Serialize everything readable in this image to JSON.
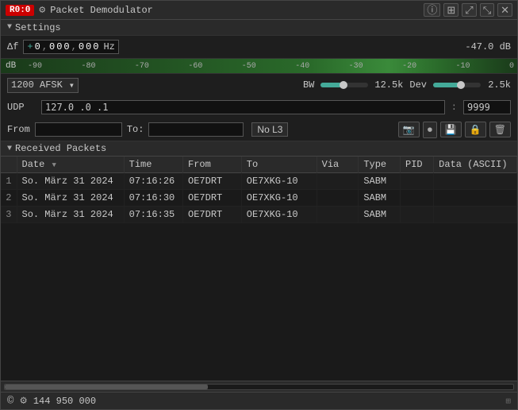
{
  "titlebar": {
    "badge": "R0:0",
    "gear_icon": "⚙",
    "title": "Packet Demodulator",
    "buttons": [
      "⊙",
      "⊞",
      "⤢",
      "⤡",
      "✕"
    ]
  },
  "settings": {
    "header_label": "Settings",
    "df_label": "Δf",
    "df_parts": [
      "+",
      "0",
      ",",
      "0",
      "0",
      "0",
      ",",
      "0",
      "0",
      "0"
    ],
    "df_unit": "Hz",
    "df_value_right": "-47.0",
    "df_db_label": "dB",
    "scale_labels": [
      "-90",
      "-80",
      "-70",
      "-60",
      "-50",
      "-40",
      "-30",
      "-20",
      "-10",
      "0"
    ],
    "db_left_label": "dB",
    "modulation": "1200 AFSK",
    "bw_label": "BW",
    "bw_value": "12.5k",
    "dev_label": "Dev",
    "dev_value": "2.5k",
    "udp_label": "UDP",
    "udp_host": "127.0 .0 .1",
    "udp_port": "9999",
    "from_label": "From",
    "from_value": "",
    "to_label": "To:",
    "to_value": "",
    "no_l3_label": "No L3",
    "action_icons": [
      "📷",
      "⏺",
      "💾",
      "🔒",
      "🗑"
    ]
  },
  "packets": {
    "header_label": "Received Packets",
    "columns": [
      "",
      "Date",
      "Time",
      "From",
      "To",
      "Via",
      "Type",
      "PID",
      "Data (ASCII)"
    ],
    "rows": [
      {
        "num": "1",
        "date": "So. März 31 2024",
        "time": "07:16:26",
        "from": "OE7DRT",
        "to": "OE7XKG-10",
        "via": "",
        "type": "SABM",
        "pid": "",
        "data": ""
      },
      {
        "num": "2",
        "date": "So. März 31 2024",
        "time": "07:16:30",
        "from": "OE7DRT",
        "to": "OE7XKG-10",
        "via": "",
        "type": "SABM",
        "pid": "",
        "data": ""
      },
      {
        "num": "3",
        "date": "So. März 31 2024",
        "time": "07:16:35",
        "from": "OE7DRT",
        "to": "OE7XKG-10",
        "via": "",
        "type": "SABM",
        "pid": "",
        "data": ""
      }
    ]
  },
  "statusbar": {
    "copy_icon": "©",
    "settings_icon": "⚙",
    "frequency": "144 950 000",
    "corner_indicator": "⊞"
  }
}
